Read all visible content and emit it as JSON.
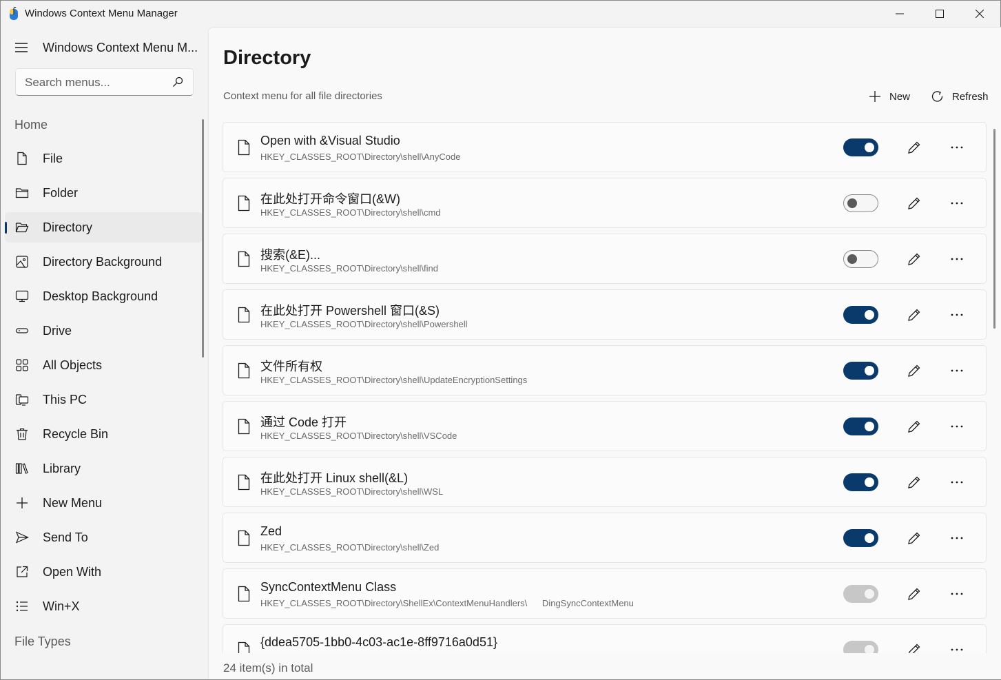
{
  "window": {
    "title": "Windows Context Menu Manager",
    "controls": [
      "minimize",
      "maximize",
      "close"
    ]
  },
  "sidebar": {
    "title": "Windows Context Menu M...",
    "search_placeholder": "Search menus...",
    "home_header": "Home",
    "items": [
      {
        "label": "File",
        "icon": "file-icon"
      },
      {
        "label": "Folder",
        "icon": "folder-icon"
      },
      {
        "label": "Directory",
        "icon": "folder-open-icon",
        "selected": true
      },
      {
        "label": "Directory Background",
        "icon": "image-icon"
      },
      {
        "label": "Desktop Background",
        "icon": "monitor-icon"
      },
      {
        "label": "Drive",
        "icon": "drive-icon"
      },
      {
        "label": "All Objects",
        "icon": "grid-icon"
      },
      {
        "label": "This PC",
        "icon": "computer-icon"
      },
      {
        "label": "Recycle Bin",
        "icon": "trash-icon"
      },
      {
        "label": "Library",
        "icon": "library-icon"
      },
      {
        "label": "New Menu",
        "icon": "plus-icon"
      },
      {
        "label": "Send To",
        "icon": "send-icon"
      },
      {
        "label": "Open With",
        "icon": "open-external-icon"
      },
      {
        "label": "Win+X",
        "icon": "list-icon"
      }
    ],
    "file_types_header": "File Types"
  },
  "main": {
    "title": "Directory",
    "subtitle": "Context menu for all file directories",
    "new_label": "New",
    "refresh_label": "Refresh",
    "rows": [
      {
        "title": "Open with &Visual Studio",
        "path": "HKEY_CLASSES_ROOT\\Directory\\shell\\AnyCode",
        "state": "on"
      },
      {
        "title": "在此处打开命令窗口(&W)",
        "path": "HKEY_CLASSES_ROOT\\Directory\\shell\\cmd",
        "state": "off"
      },
      {
        "title": "搜索(&E)...",
        "path": "HKEY_CLASSES_ROOT\\Directory\\shell\\find",
        "state": "off"
      },
      {
        "title": "在此处打开 Powershell 窗口(&S)",
        "path": "HKEY_CLASSES_ROOT\\Directory\\shell\\Powershell",
        "state": "on"
      },
      {
        "title": "文件所有权",
        "path": "HKEY_CLASSES_ROOT\\Directory\\shell\\UpdateEncryptionSettings",
        "state": "on"
      },
      {
        "title": "通过 Code 打开",
        "path": "HKEY_CLASSES_ROOT\\Directory\\shell\\VSCode",
        "state": "on"
      },
      {
        "title": "在此处打开 Linux shell(&L)",
        "path": "HKEY_CLASSES_ROOT\\Directory\\shell\\WSL",
        "state": "on"
      },
      {
        "title": "Zed",
        "path": "HKEY_CLASSES_ROOT\\Directory\\shell\\Zed",
        "state": "on"
      },
      {
        "title": "SyncContextMenu Class",
        "path": "HKEY_CLASSES_ROOT\\Directory\\ShellEx\\ContextMenuHandlers\\      DingSyncContextMenu",
        "state": "disabled"
      },
      {
        "title": "{ddea5705-1bb0-4c03-ac1e-8ff9716a0d51}",
        "path": "",
        "state": "disabled"
      }
    ],
    "footer": "24 item(s) in total"
  },
  "colors": {
    "accent": "#0a3a6b",
    "toggle_disabled": "#c7c7c7"
  }
}
